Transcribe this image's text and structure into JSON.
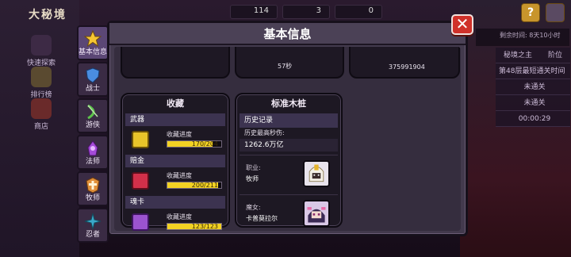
{
  "scene": {
    "title": "大秘境",
    "side": [
      "快速探索",
      "排行榜",
      "商店"
    ],
    "resources": [
      "114",
      "3",
      "0"
    ],
    "right_panel": {
      "top": "剩余时间: 8天10小时",
      "tabs": [
        "秘境之主",
        "阶位"
      ],
      "heading": "第48层最短通关时间",
      "rows": [
        "未通关",
        "未通关",
        "00:00:29"
      ]
    }
  },
  "tabs": [
    {
      "label": "基本信息",
      "color": "#f5c632"
    },
    {
      "label": "战士",
      "color": "#4a8de0"
    },
    {
      "label": "游侠",
      "color": "#5cc24b"
    },
    {
      "label": "法师",
      "color": "#a44ad8"
    },
    {
      "label": "牧师",
      "color": "#e0903a"
    },
    {
      "label": "忍者",
      "color": "#3aa8c9"
    }
  ],
  "dialog": {
    "title": "基本信息",
    "close": "✕",
    "top_values": [
      "57秒",
      "375991904"
    ],
    "collection": {
      "title": "收藏",
      "sections": [
        {
          "name": "武器",
          "label": "收藏进度",
          "progress": "170/204",
          "fill": 0.833,
          "color": "#e8c42a"
        },
        {
          "name": "赔金",
          "label": "收藏进度",
          "progress": "200/211",
          "fill": 0.948,
          "color": "#d2304a"
        },
        {
          "name": "魂卡",
          "label": "收藏进度",
          "progress": "123/123",
          "fill": 1.0,
          "color": "#9b53cf"
        }
      ]
    },
    "dummy": {
      "title": "标准木桩",
      "history": "历史记录",
      "max_label": "历史最高秒伤:",
      "max_value": "1262.6万亿",
      "job_label": "职业:",
      "job_value": "牧师",
      "pet_label": "魔女:",
      "pet_value": "卡普莫拉尔"
    }
  }
}
